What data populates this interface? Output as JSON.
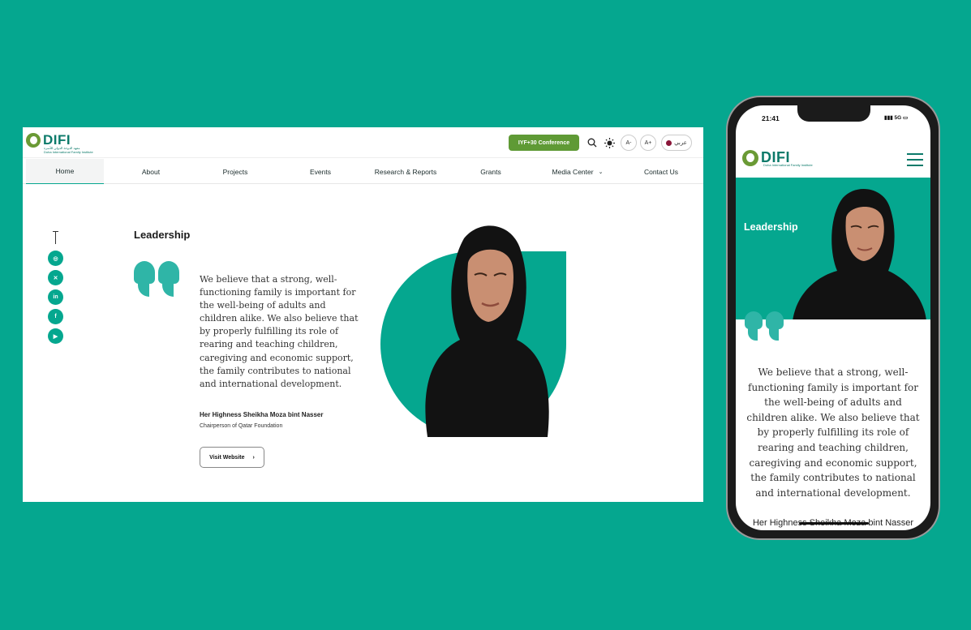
{
  "desktop": {
    "logo": {
      "word": "DIFI",
      "sub_ar": "معهد الدوحة الدولي للأسرة",
      "sub_en": "Doha International Family Institute"
    },
    "header": {
      "conference_label": "IYF+30 Conference",
      "font_decrease": "A-",
      "font_increase": "A+",
      "language": "عربي"
    },
    "nav": [
      {
        "label": "Home"
      },
      {
        "label": "About"
      },
      {
        "label": "Projects"
      },
      {
        "label": "Events"
      },
      {
        "label": "Research & Reports"
      },
      {
        "label": "Grants"
      },
      {
        "label": "Media Center"
      },
      {
        "label": "Contact Us"
      }
    ],
    "social": [
      {
        "icon": "instagram-icon",
        "glyph": "◎"
      },
      {
        "icon": "x-icon",
        "glyph": "✕"
      },
      {
        "icon": "linkedin-icon",
        "glyph": "in"
      },
      {
        "icon": "facebook-icon",
        "glyph": "f"
      },
      {
        "icon": "youtube-icon",
        "glyph": "▶"
      }
    ],
    "section_title": "Leadership",
    "quote": "We believe that a strong, well-functioning family is important for the well-being of adults and children alike. We also believe that by properly fulfilling its role of rearing and teaching children, caregiving and economic support, the family contributes to national and international development.",
    "name": "Her Highness Sheikha Moza bint Nasser",
    "role": "Chairperson of Qatar Foundation",
    "visit_label": "Visit Website"
  },
  "phone": {
    "time": "21:41",
    "status": "5G",
    "logo": {
      "word": "DIFI",
      "sub_en": "Doha International Family Institute"
    },
    "section_title": "Leadership",
    "quote": "We believe that a strong, well-functioning family is important for the well-being of adults and children alike. We also believe that by properly fulfilling its role of rearing and teaching children, caregiving and economic support, the family contributes to national and international development.",
    "name": "Her Highness Sheikha Moza bint Nasser"
  },
  "colors": {
    "background": "#05a78f",
    "accent": "#05a78f",
    "conference_button": "#5f9a35",
    "logo_text": "#0c7a6a"
  }
}
